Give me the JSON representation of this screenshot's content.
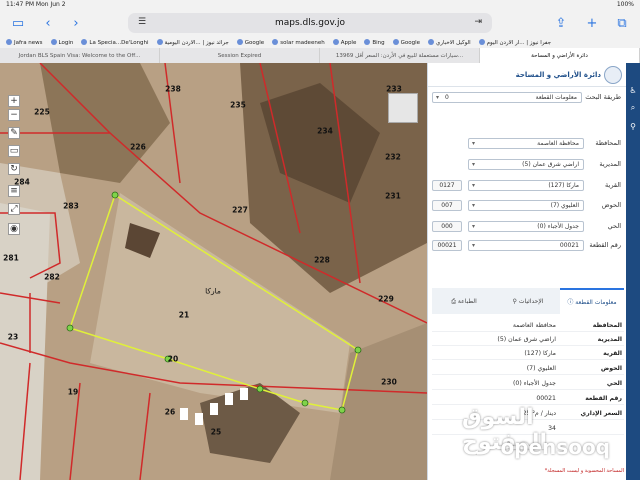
{
  "status": {
    "time_date": "11:47 PM   Mon Jun 2",
    "battery": "100%"
  },
  "browser": {
    "url": "maps.dls.gov.jo",
    "bookmarks": [
      "Jafra news",
      "Login",
      "La Specia...De'Longhi",
      "جرائد نيوز | ...الاردن اليومية",
      "Google",
      "solar madeeneh",
      "Apple",
      "Bing",
      "Google",
      "الوكيل الاخباري",
      "جفرا نيوز | ...ار الاردن اليوم"
    ],
    "tabs": [
      "Jordan BLS Spain Visa: Welcome to the Off...",
      "Session Expired",
      "13969 سيارات مستعملة للبيع في الأردن: السعر أقل...",
      "دائرة الأراضي و المساحة"
    ]
  },
  "map": {
    "parcels": [
      {
        "n": "238"
      },
      {
        "n": "235"
      },
      {
        "n": "233"
      },
      {
        "n": "225"
      },
      {
        "n": "226"
      },
      {
        "n": "234"
      },
      {
        "n": "232"
      },
      {
        "n": "231"
      },
      {
        "n": "284"
      },
      {
        "n": "283"
      },
      {
        "n": "227"
      },
      {
        "n": "281"
      },
      {
        "n": "282"
      },
      {
        "n": "228"
      },
      {
        "n": "229"
      },
      {
        "n": "21"
      },
      {
        "n": "23"
      },
      {
        "n": "20"
      },
      {
        "n": "230"
      },
      {
        "n": "19"
      },
      {
        "n": "26"
      },
      {
        "n": "25"
      }
    ],
    "area_label": "ماركا"
  },
  "panel": {
    "title": "دائرة الأراضي و المساحة",
    "search_method_label": "طريقة البحث",
    "search_method_value": "معلومات القطعة",
    "search_code": "0",
    "fields": [
      {
        "label": "المحافظة",
        "value": "محافظة العاصمة",
        "code": ""
      },
      {
        "label": "المديرية",
        "value": "اراضي شرق عمان (5)",
        "code": ""
      },
      {
        "label": "القرية",
        "value": "ماركا (127)",
        "code": "0127"
      },
      {
        "label": "الحوض",
        "value": "العليوي (7)",
        "code": "007"
      },
      {
        "label": "الحي",
        "value": "جدول الأجباء (0)",
        "code": "000"
      },
      {
        "label": "رقم القطعة",
        "value": "00021",
        "code": "00021"
      }
    ],
    "tabs": [
      {
        "label": "معلومات القطعة",
        "icon": "info-icon"
      },
      {
        "label": "الإحداثيات",
        "icon": "pin-icon"
      },
      {
        "label": "الطباعة",
        "icon": "print-icon"
      }
    ],
    "info": [
      {
        "k": "المحافظة",
        "v": "محافظة العاصمة"
      },
      {
        "k": "المديرية",
        "v": "اراضي شرق عمان (5)"
      },
      {
        "k": "القرية",
        "v": "ماركا (127)"
      },
      {
        "k": "الحوض",
        "v": "العليوي (7)"
      },
      {
        "k": "الحي",
        "v": "جدول الأجباء (0)"
      },
      {
        "k": "رقم القطعة",
        "v": "00021"
      },
      {
        "k": "السعر الإداري",
        "v": "25 دينار / م²"
      },
      {
        "k": "",
        "v": "34"
      }
    ],
    "note": "*المساحة المحسوبة و ليست المسجلة"
  },
  "watermark": {
    "arabic": "السوق المفتوح",
    "latin": "opensooq"
  },
  "colors": {
    "panel_accent": "#1f4f8a",
    "rail": "#1d4a80",
    "parcel_line": "#d02a2a",
    "selection_line": "#e0f03a"
  }
}
